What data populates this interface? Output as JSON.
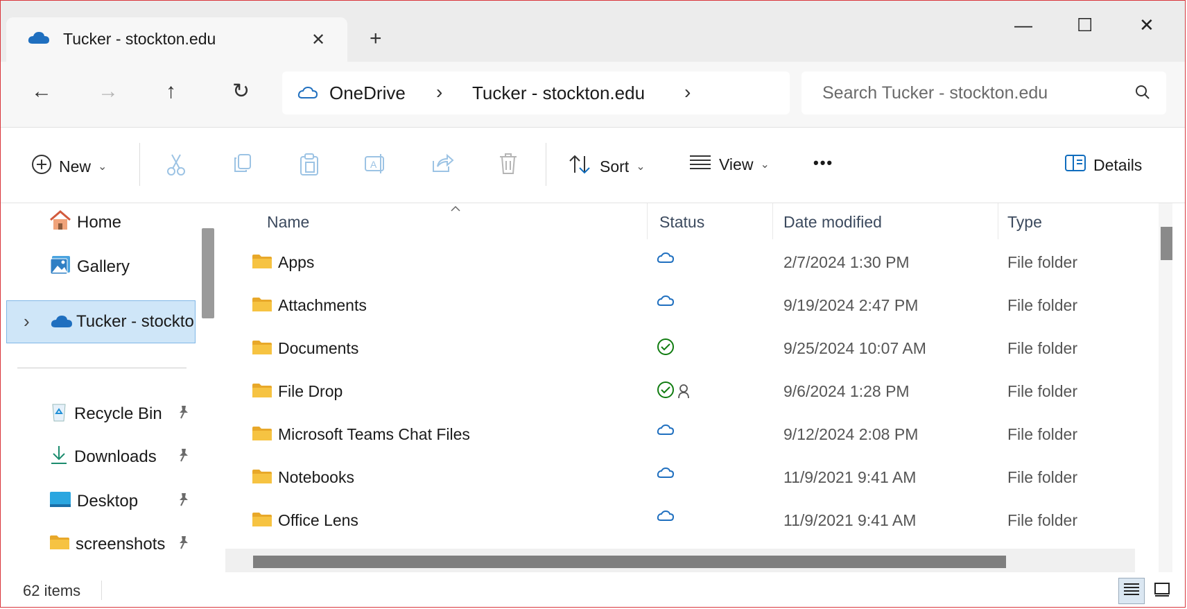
{
  "window": {
    "tab_title": "Tucker - stockton.edu",
    "new_tab": "+",
    "minimize": "—",
    "maximize": "☐",
    "close": "✕"
  },
  "nav": {
    "back": "←",
    "forward": "→",
    "up": "↑",
    "refresh": "↻",
    "breadcrumb": [
      "OneDrive",
      "Tucker - stockton.edu"
    ],
    "chevron": "›",
    "search_placeholder": "Search Tucker - stockton.edu"
  },
  "toolbar": {
    "new_label": "New",
    "sort_label": "Sort",
    "view_label": "View",
    "more_label": "•••",
    "details_label": "Details",
    "dropdown_caret": "⌄"
  },
  "sidebar": {
    "items": [
      {
        "label": "Home",
        "icon": "home-icon"
      },
      {
        "label": "Gallery",
        "icon": "gallery-icon"
      },
      {
        "label": "Tucker - stockto",
        "icon": "onedrive-cloud-icon",
        "selected": true
      },
      {
        "label": "Recycle Bin",
        "icon": "recycle-bin-icon",
        "pinned": true
      },
      {
        "label": "Downloads",
        "icon": "downloads-icon",
        "pinned": true
      },
      {
        "label": "Desktop",
        "icon": "desktop-icon",
        "pinned": true
      },
      {
        "label": "screenshots",
        "icon": "folder-icon",
        "pinned": true
      }
    ],
    "expand_chevron": "›",
    "pin_glyph": "📌"
  },
  "columns": {
    "name": "Name",
    "status": "Status",
    "date": "Date modified",
    "type": "Type"
  },
  "files": [
    {
      "name": "Apps",
      "status": "cloud",
      "date": "2/7/2024 1:30 PM",
      "type": "File folder"
    },
    {
      "name": "Attachments",
      "status": "cloud",
      "date": "9/19/2024 2:47 PM",
      "type": "File folder"
    },
    {
      "name": "Documents",
      "status": "synced",
      "date": "9/25/2024 10:07 AM",
      "type": "File folder"
    },
    {
      "name": "File Drop",
      "status": "synced-shared",
      "date": "9/6/2024 1:28 PM",
      "type": "File folder"
    },
    {
      "name": "Microsoft Teams Chat Files",
      "status": "cloud",
      "date": "9/12/2024 2:08 PM",
      "type": "File folder"
    },
    {
      "name": "Notebooks",
      "status": "cloud",
      "date": "11/9/2021 9:41 AM",
      "type": "File folder"
    },
    {
      "name": "Office Lens",
      "status": "cloud",
      "date": "11/9/2021 9:41 AM",
      "type": "File folder"
    }
  ],
  "statusbar": {
    "count": "62 items"
  },
  "colors": {
    "accent": "#0f6cbd",
    "cloud_blue": "#1f6fbf",
    "synced_green": "#107c10",
    "folder_yellow": "#f6c342",
    "window_border": "#d9343a"
  }
}
